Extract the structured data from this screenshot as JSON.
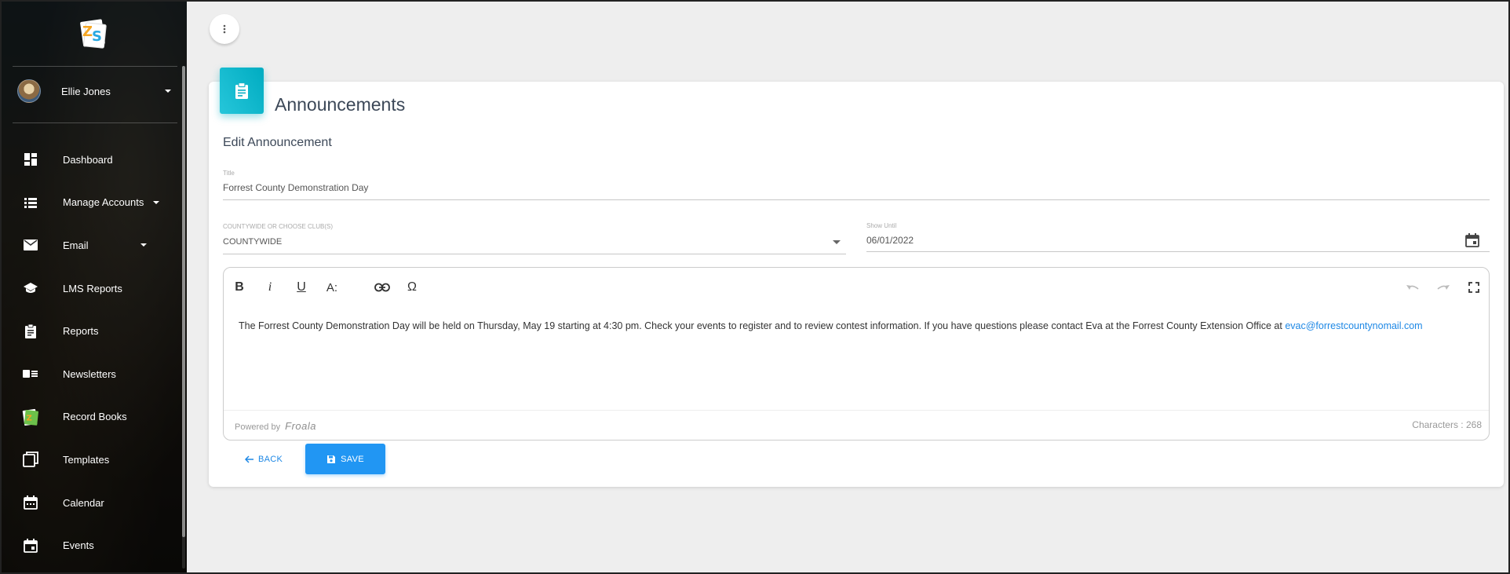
{
  "sidebar": {
    "user": {
      "name": "Ellie Jones"
    },
    "items": [
      {
        "label": "Dashboard",
        "icon": "dashboard-icon",
        "has_caret": false
      },
      {
        "label": "Manage Accounts",
        "icon": "list-icon",
        "has_caret": true
      },
      {
        "label": "Email",
        "icon": "mail-icon",
        "has_caret": true
      },
      {
        "label": "LMS Reports",
        "icon": "school-icon",
        "has_caret": false
      },
      {
        "label": "Reports",
        "icon": "clipboard-icon",
        "has_caret": false
      },
      {
        "label": "Newsletters",
        "icon": "newsletter-icon",
        "has_caret": false
      },
      {
        "label": "Record Books",
        "icon": "record-books-logo-icon",
        "has_caret": false
      },
      {
        "label": "Templates",
        "icon": "templates-icon",
        "has_caret": false
      },
      {
        "label": "Calendar",
        "icon": "calendar-icon",
        "has_caret": false
      },
      {
        "label": "Events",
        "icon": "event-icon",
        "has_caret": false
      }
    ]
  },
  "page": {
    "title": "Announcements",
    "subtitle": "Edit Announcement"
  },
  "form": {
    "title_label": "Title",
    "title_value": "Forrest County Demonstration Day",
    "scope_label": "COUNTYWIDE OR CHOOSE CLUB(S)",
    "scope_value": "COUNTYWIDE",
    "show_until_label": "Show Until",
    "show_until_value": "06/01/2022"
  },
  "editor": {
    "toolbar": {
      "bold": "B",
      "italic": "i",
      "underline": "U",
      "font_size": "A:",
      "special_chars": "Ω"
    },
    "body_text": "The Forrest County Demonstration Day will be held on Thursday, May 19 starting at 4:30 pm. Check your events to register and to review contest information. If you have questions please contact Eva at the Forrest County Extension Office at ",
    "body_link": "evac@forrestcountynomail.com",
    "powered_by": "Powered by",
    "brand": "Froala",
    "char_count": "Characters : 268"
  },
  "actions": {
    "back_label": "BACK",
    "save_label": "SAVE"
  },
  "colors": {
    "accent": "#2196f3",
    "card_icon": "#00acc1",
    "link": "#1e88e5"
  }
}
